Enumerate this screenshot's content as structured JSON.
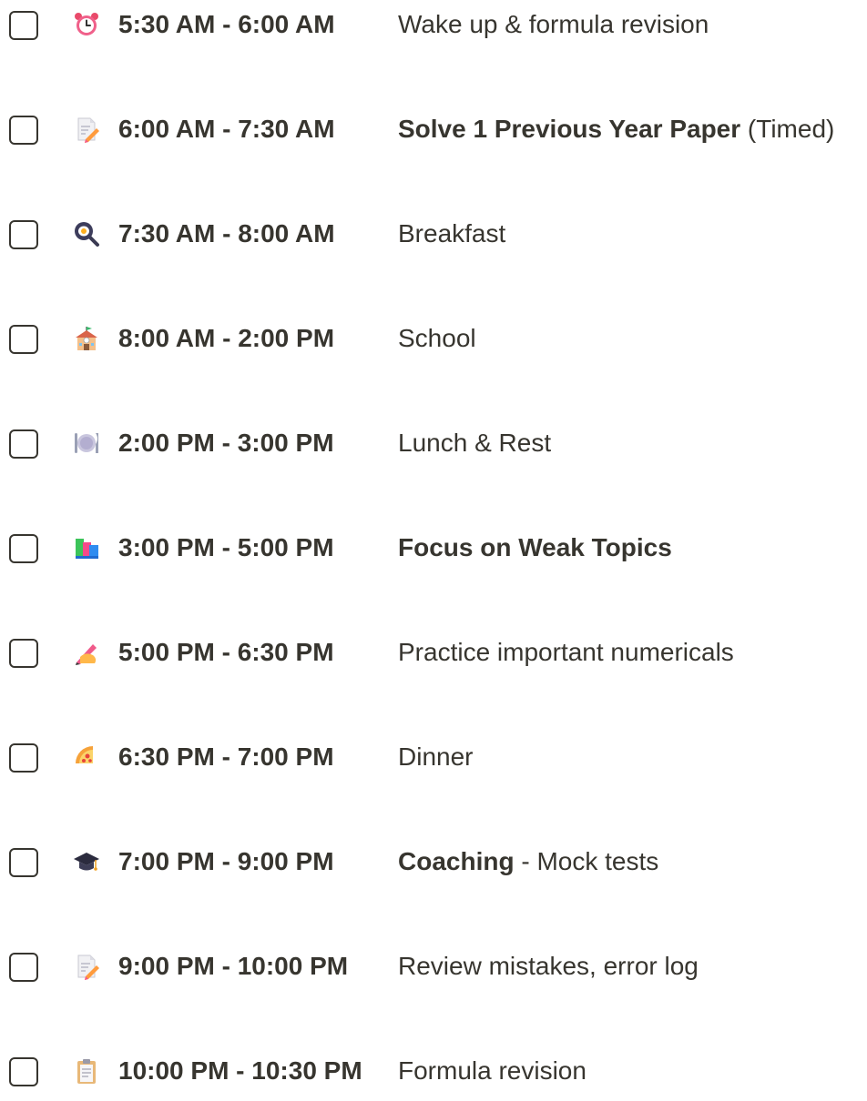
{
  "items": [
    {
      "icon": "alarm-clock-icon",
      "time": "5:30 AM - 6:00 AM",
      "task_bold": "",
      "task_text": "Wake up & formula revision"
    },
    {
      "icon": "memo-icon",
      "time": "6:00 AM - 7:30 AM",
      "task_bold": "Solve 1 Previous Year Paper",
      "task_text": " (Timed)"
    },
    {
      "icon": "frying-pan-egg-icon",
      "time": "7:30 AM - 8:00 AM",
      "task_bold": "",
      "task_text": "Breakfast"
    },
    {
      "icon": "school-icon",
      "time": "8:00 AM - 2:00 PM",
      "task_bold": "",
      "task_text": "School"
    },
    {
      "icon": "fork-knife-plate-icon",
      "time": "2:00 PM - 3:00 PM",
      "task_bold": "",
      "task_text": "Lunch & Rest"
    },
    {
      "icon": "books-icon",
      "time": "3:00 PM - 5:00 PM",
      "task_bold": "Focus on Weak Topics",
      "task_text": ""
    },
    {
      "icon": "writing-hand-icon",
      "time": "5:00 PM - 6:30 PM",
      "task_bold": "",
      "task_text": "Practice important numericals"
    },
    {
      "icon": "pizza-icon",
      "time": "6:30 PM - 7:00 PM",
      "task_bold": "",
      "task_text": "Dinner"
    },
    {
      "icon": "graduation-cap-icon",
      "time": "7:00 PM - 9:00 PM",
      "task_bold": "Coaching",
      "task_text": " - Mock tests"
    },
    {
      "icon": "memo-icon",
      "time": "9:00 PM - 10:00 PM",
      "task_bold": "",
      "task_text": "Review mistakes, error log"
    },
    {
      "icon": "clipboard-icon",
      "time": "10:00 PM - 10:30 PM",
      "task_bold": "",
      "task_text": "Formula revision"
    }
  ],
  "colors": {
    "text": "#37352f",
    "checkbox_border": "#37352f"
  }
}
